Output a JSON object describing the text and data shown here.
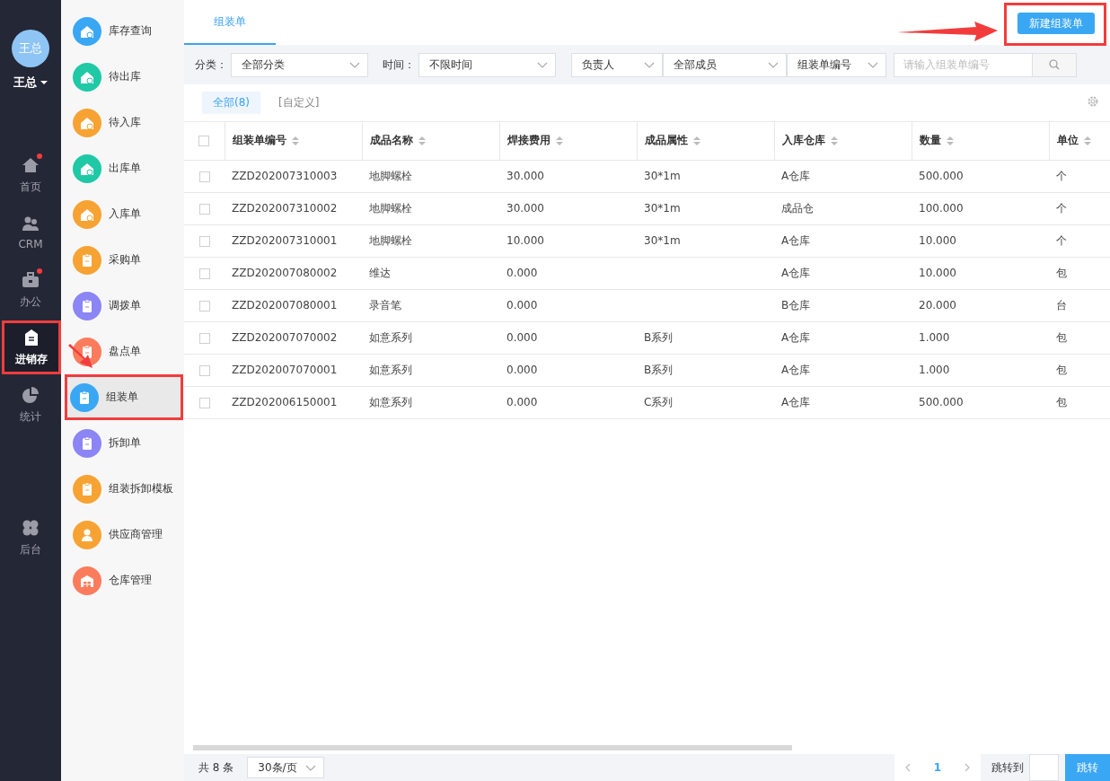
{
  "user": {
    "avatar": "王总",
    "name": "王总"
  },
  "nav": {
    "items": [
      {
        "label": "首页",
        "kind": "home",
        "badge": true,
        "selected": false,
        "highlighted": false
      },
      {
        "label": "CRM",
        "kind": "people",
        "badge": false,
        "selected": false,
        "highlighted": false
      },
      {
        "label": "办公",
        "kind": "case",
        "badge": true,
        "selected": false,
        "highlighted": false
      },
      {
        "label": "进销存",
        "kind": "doc",
        "badge": false,
        "selected": true,
        "highlighted": true
      },
      {
        "label": "统计",
        "kind": "pie",
        "badge": false,
        "selected": false,
        "highlighted": false
      }
    ],
    "footer_items": [
      {
        "label": "后台",
        "kind": "grid",
        "badge": false,
        "selected": false,
        "highlighted": false
      }
    ]
  },
  "submenu": [
    {
      "label": "库存查询",
      "kind": "house",
      "color": "#3aa7f5",
      "selected": false,
      "highlighted": false
    },
    {
      "label": "待出库",
      "kind": "house",
      "color": "#1fc9a5",
      "selected": false,
      "highlighted": false
    },
    {
      "label": "待入库",
      "kind": "house",
      "color": "#f7a334",
      "selected": false,
      "highlighted": false
    },
    {
      "label": "出库单",
      "kind": "house",
      "color": "#1fc9a5",
      "selected": false,
      "highlighted": false
    },
    {
      "label": "入库单",
      "kind": "house",
      "color": "#f7a334",
      "selected": false,
      "highlighted": false
    },
    {
      "label": "采购单",
      "kind": "clip",
      "color": "#f7a334",
      "selected": false,
      "highlighted": false
    },
    {
      "label": "调拨单",
      "kind": "clip",
      "color": "#8b85f5",
      "selected": false,
      "highlighted": false
    },
    {
      "label": "盘点单",
      "kind": "clip",
      "color": "#fb7c5c",
      "selected": false,
      "highlighted": false
    },
    {
      "label": "组装单",
      "kind": "clip",
      "color": "#3aa7f5",
      "selected": true,
      "highlighted": true
    },
    {
      "label": "拆卸单",
      "kind": "clip",
      "color": "#8b85f5",
      "selected": false,
      "highlighted": false
    },
    {
      "label": "组装拆卸模板",
      "kind": "clip",
      "color": "#f7a334",
      "selected": false,
      "highlighted": false
    },
    {
      "label": "供应商管理",
      "kind": "person",
      "color": "#f7a334",
      "selected": false,
      "highlighted": false
    },
    {
      "label": "仓库管理",
      "kind": "store",
      "color": "#fb7c5c",
      "selected": false,
      "highlighted": false
    }
  ],
  "page_tabs": [
    {
      "label": "组装单",
      "selected": true
    }
  ],
  "new_button": {
    "label": "新建组装单",
    "highlighted": true
  },
  "filters": {
    "category_label": "分类：",
    "category": "全部分类",
    "time_label": "时间：",
    "time": "不限时间",
    "owner": "负责人",
    "members": "全部成员",
    "search_field": "组装单编号",
    "search_placeholder": "请输入组装单编号"
  },
  "views": [
    {
      "label": "全部(8)",
      "selected": true
    },
    {
      "label": "[自定义]",
      "selected": false
    }
  ],
  "table": {
    "all_checked": false,
    "columns": [
      "组装单编号",
      "成品名称",
      "焊接费用",
      "成品属性",
      "入库仓库",
      "数量",
      "单位"
    ],
    "rows": [
      {
        "checked": false,
        "cells": [
          "ZZD202007310003",
          "地脚螺栓",
          "30.000",
          "30*1m",
          "A仓库",
          "500.000",
          "个"
        ]
      },
      {
        "checked": false,
        "cells": [
          "ZZD202007310002",
          "地脚螺栓",
          "30.000",
          "30*1m",
          "成品仓",
          "100.000",
          "个"
        ]
      },
      {
        "checked": false,
        "cells": [
          "ZZD202007310001",
          "地脚螺栓",
          "10.000",
          "30*1m",
          "A仓库",
          "10.000",
          "个"
        ]
      },
      {
        "checked": false,
        "cells": [
          "ZZD202007080002",
          "维达",
          "0.000",
          "",
          "A仓库",
          "10.000",
          "包"
        ]
      },
      {
        "checked": false,
        "cells": [
          "ZZD202007080001",
          "录音笔",
          "0.000",
          "",
          "B仓库",
          "20.000",
          "台"
        ]
      },
      {
        "checked": false,
        "cells": [
          "ZZD202007070002",
          "如意系列",
          "0.000",
          "B系列",
          "A仓库",
          "1.000",
          "包"
        ]
      },
      {
        "checked": false,
        "cells": [
          "ZZD202007070001",
          "如意系列",
          "0.000",
          "B系列",
          "A仓库",
          "1.000",
          "包"
        ]
      },
      {
        "checked": false,
        "cells": [
          "ZZD202006150001",
          "如意系列",
          "0.000",
          "C系列",
          "A仓库",
          "500.000",
          "包"
        ]
      }
    ]
  },
  "footer": {
    "total": "共 8 条",
    "page_size": "30条/页",
    "pages": [
      {
        "label": "1",
        "selected": true
      }
    ],
    "jump_label": "跳转到",
    "jump_button": "跳转"
  }
}
